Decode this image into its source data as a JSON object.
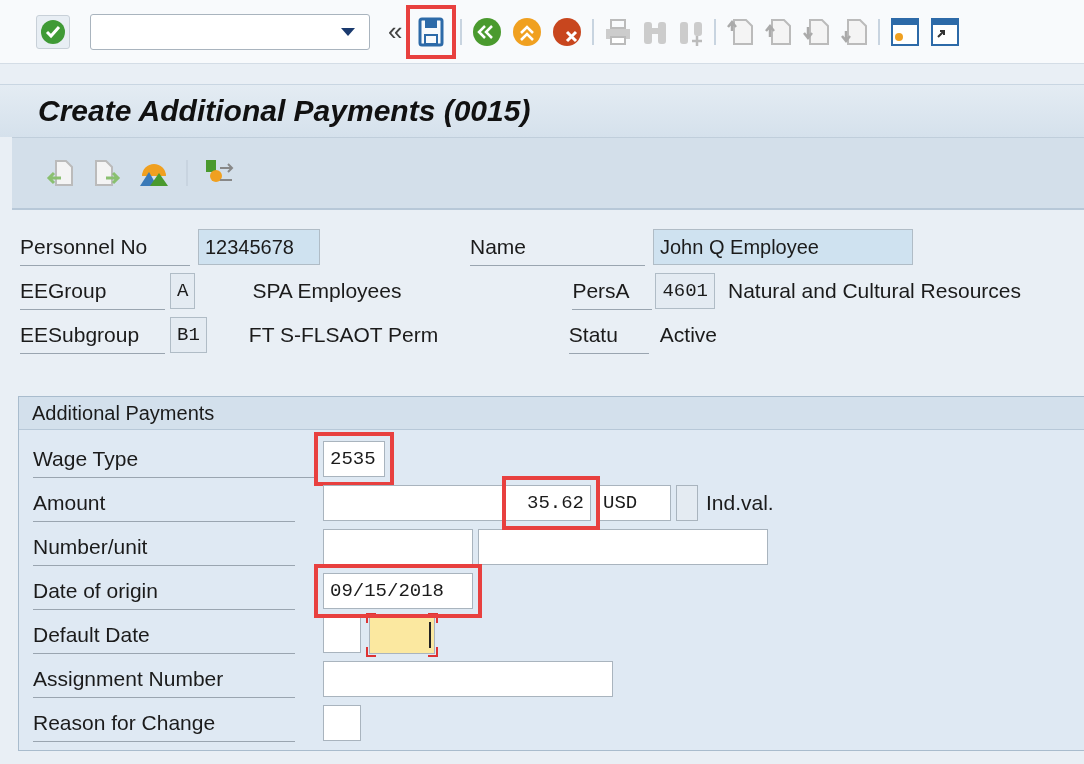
{
  "system_toolbar": {
    "command_field": {
      "expanded": false
    },
    "collapse": "«",
    "save_highlighted": true
  },
  "title": "Create Additional Payments (0015)",
  "header": {
    "personnel_no": {
      "label": "Personnel No",
      "value": "12345678"
    },
    "name": {
      "label": "Name",
      "value": "John Q Employee"
    },
    "ee_group": {
      "label": "EEGroup",
      "value": "A",
      "text": "SPA Employees"
    },
    "pers_area": {
      "label": "PersA",
      "value": "4601",
      "text": "Natural and Cultural Resources"
    },
    "ee_subgroup": {
      "label": "EESubgroup",
      "value": "B1",
      "text": "FT S-FLSAOT Perm"
    },
    "status": {
      "label": "Statu",
      "text": "Active"
    }
  },
  "payments": {
    "title": "Additional Payments",
    "rows": [
      {
        "kind": "code",
        "label": "Wage Type",
        "value": "2535",
        "highlighted": true
      },
      {
        "kind": "amount",
        "label": "Amount",
        "value": "35.62",
        "currency": "USD",
        "highlighted": true,
        "checkbox": {
          "label": "Ind.val.",
          "checked": false
        }
      },
      {
        "kind": "pair",
        "label": "Number/unit"
      },
      {
        "kind": "date",
        "label": "Date of origin",
        "value": "09/15/2018",
        "highlighted": true
      },
      {
        "kind": "default_date",
        "label": "Default Date",
        "focused": true
      },
      {
        "kind": "wide",
        "label": "Assignment Number"
      },
      {
        "kind": "short",
        "label": "Reason for Change"
      }
    ]
  }
}
